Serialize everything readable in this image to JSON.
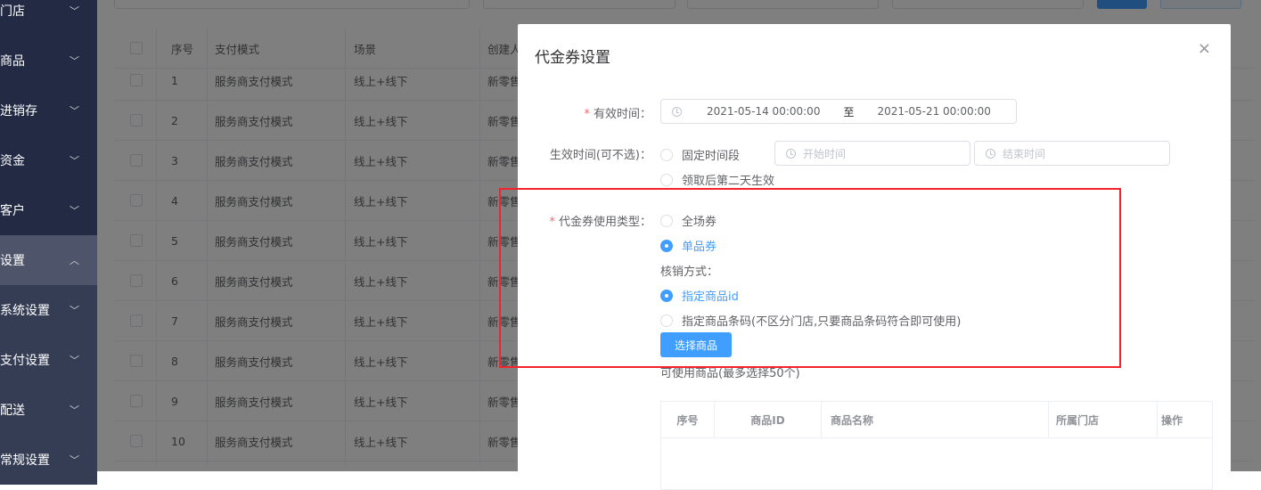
{
  "sidebar": {
    "items": [
      {
        "label": "门店",
        "expanded": false
      },
      {
        "label": "商品",
        "expanded": false
      },
      {
        "label": "进销存",
        "expanded": false
      },
      {
        "label": "资金",
        "expanded": false
      },
      {
        "label": "客户",
        "expanded": false
      },
      {
        "label": "设置",
        "expanded": true
      },
      {
        "label": "系统设置",
        "expanded": false
      },
      {
        "label": "支付设置",
        "expanded": false
      },
      {
        "label": "配送",
        "expanded": false
      },
      {
        "label": "常规设置",
        "expanded": false
      }
    ]
  },
  "table": {
    "headers": [
      "序号",
      "支付模式",
      "场景",
      "创建人"
    ],
    "rows": [
      [
        "1",
        "服务商支付模式",
        "线上+线下",
        "新零售"
      ],
      [
        "2",
        "服务商支付模式",
        "线上+线下",
        "新零售"
      ],
      [
        "3",
        "服务商支付模式",
        "线上+线下",
        "新零售"
      ],
      [
        "4",
        "服务商支付模式",
        "线上+线下",
        "新零售"
      ],
      [
        "5",
        "服务商支付模式",
        "线上+线下",
        "新零售"
      ],
      [
        "6",
        "服务商支付模式",
        "线上+线下",
        "新零售"
      ],
      [
        "7",
        "服务商支付模式",
        "线上+线下",
        "新零售"
      ],
      [
        "8",
        "服务商支付模式",
        "线上+线下",
        "新零售"
      ],
      [
        "9",
        "服务商支付模式",
        "线上+线下",
        "新零售"
      ],
      [
        "10",
        "服务商支付模式",
        "线上+线下",
        "新零售"
      ]
    ]
  },
  "modal": {
    "title": "代金券设置",
    "close": "×",
    "valid_time": {
      "label": "有效时间：",
      "start": "2021-05-14 00:00:00",
      "sep": "至",
      "end": "2021-05-21 00:00:00"
    },
    "effective_time": {
      "label": "生效时间(可不选)：",
      "option_fixed": "固定时间段",
      "start_placeholder": "开始时间",
      "end_placeholder": "结束时间",
      "option_next_day": "领取后第二天生效"
    },
    "usage_type": {
      "label": "代金券使用类型：",
      "option_all": "全场券",
      "option_single": "单品券",
      "verify_label": "核销方式：",
      "verify_by_id": "指定商品id",
      "verify_by_barcode": "指定商品条码(不区分门店,只要商品条码符合即可使用)",
      "select_button": "选择商品"
    },
    "available_label": "可使用商品(最多选择50个)",
    "goods_table": {
      "headers": [
        "序号",
        "商品ID",
        "商品名称",
        "所属门店",
        "操作"
      ]
    }
  },
  "colors": {
    "primary": "#409eff",
    "highlight": "#f5222d",
    "sidebar": "#222a44"
  }
}
